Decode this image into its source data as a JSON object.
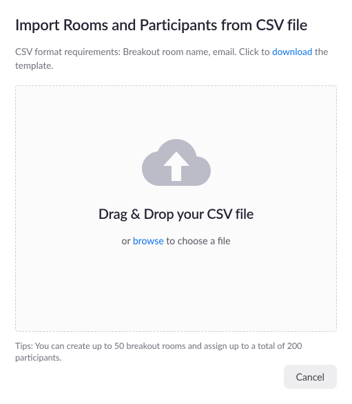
{
  "title": "Import Rooms and Participants from CSV file",
  "subtitle": {
    "prefix": "CSV format requirements: Breakout room name, email. Click to ",
    "link": "download",
    "suffix": " the template."
  },
  "dropzone": {
    "icon": "cloud-upload-icon",
    "title": "Drag & Drop your CSV file",
    "sub_prefix": "or ",
    "browse": "browse",
    "sub_suffix": " to choose a file"
  },
  "tips": "Tips: You can create up to 50 breakout rooms and assign up to a total of 200 participants.",
  "buttons": {
    "cancel": "Cancel"
  },
  "colors": {
    "link": "#0e72ed",
    "icon": "#bcbcc8",
    "text_primary": "#232333",
    "text_secondary": "#6e6e7a"
  }
}
